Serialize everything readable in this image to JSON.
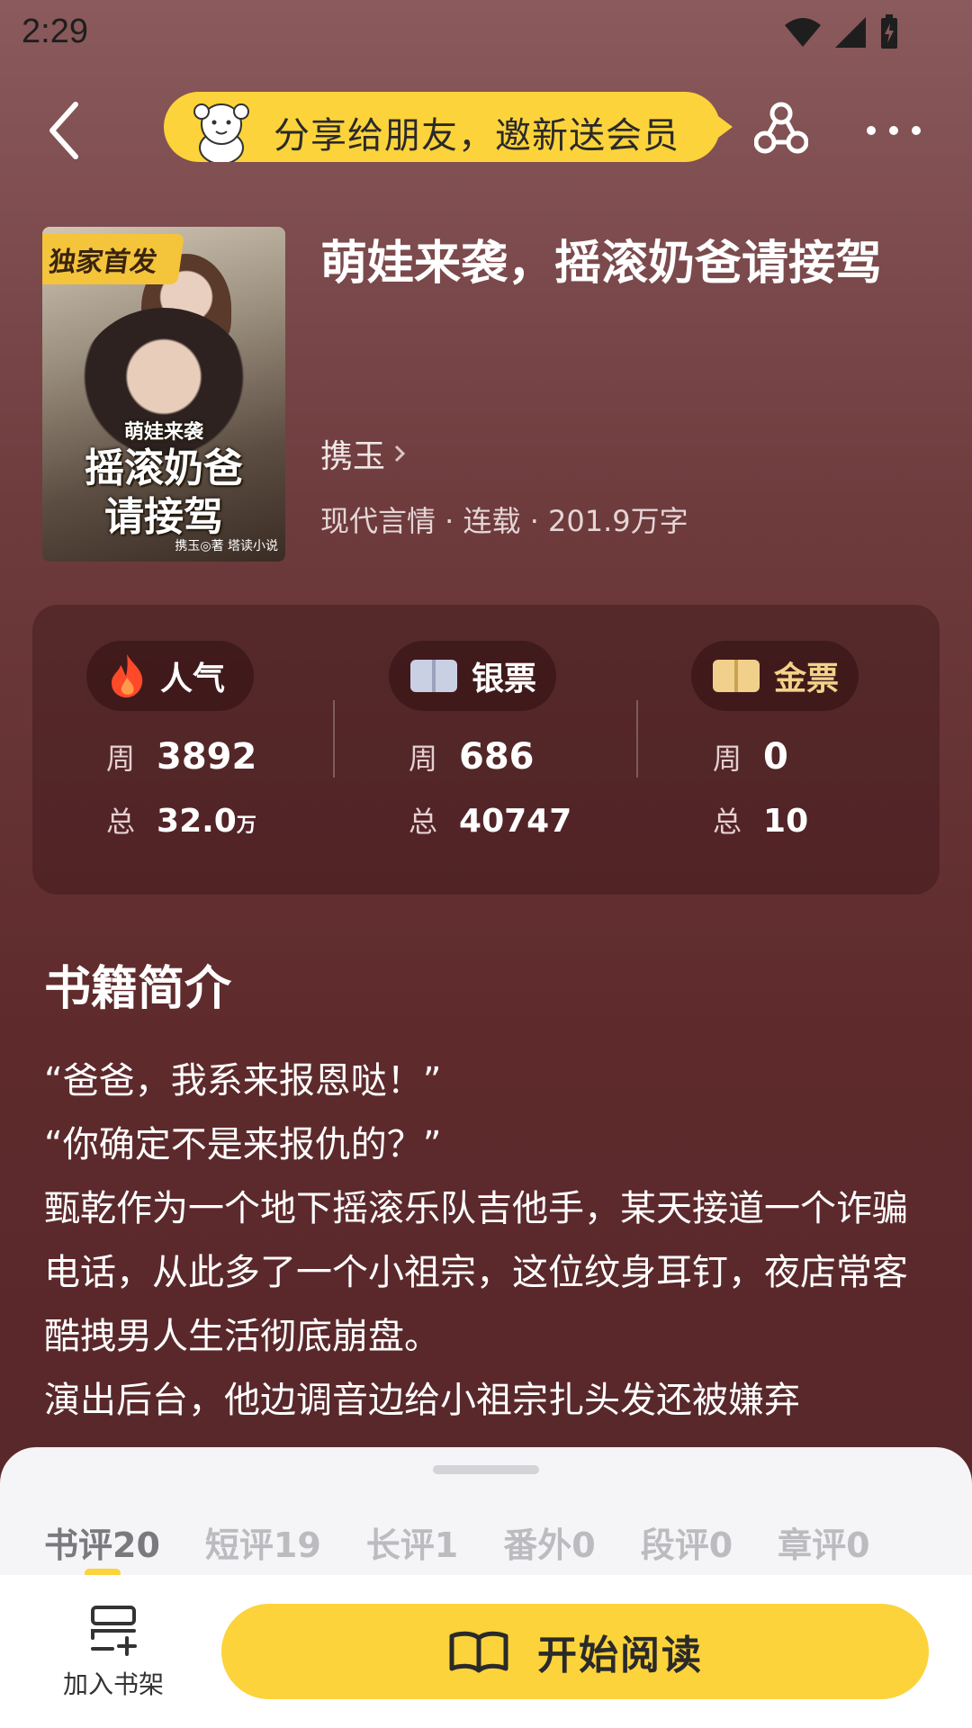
{
  "status_bar": {
    "time": "2:29"
  },
  "header": {
    "share_banner": "分享给朋友，邀新送会员"
  },
  "book": {
    "cover_badge": "独家首发",
    "cover_title_small": "萌娃来袭",
    "cover_title_line1": "摇滚奶爸",
    "cover_title_line2": "请接驾",
    "cover_footer": "携玉◎著  塔读小说",
    "title": "萌娃来袭，摇滚奶爸请接驾",
    "author": "携玉",
    "meta": "现代言情 · 连载 · 201.9万字"
  },
  "stats": [
    {
      "label": "人气",
      "week_label": "周",
      "week": "3892",
      "total_label": "总",
      "total": "32.0",
      "total_unit": "万"
    },
    {
      "label": "银票",
      "week_label": "周",
      "week": "686",
      "total_label": "总",
      "total": "40747",
      "total_unit": ""
    },
    {
      "label": "金票",
      "week_label": "周",
      "week": "0",
      "total_label": "总",
      "total": "10",
      "total_unit": ""
    }
  ],
  "intro": {
    "title": "书籍简介",
    "lines": [
      "“爸爸，我系来报恩哒！”",
      "“你确定不是来报仇的？”",
      "甄乾作为一个地下摇滚乐队吉他手，某天接道一个诈骗电话，从此多了一个小祖宗，这位纹身耳钉，夜店常客酷拽男人生活彻底崩盘。",
      "演出后台，他边调音边给小祖宗扎头发还被嫌弃"
    ]
  },
  "tabs": [
    "书评20",
    "短评19",
    "长评1",
    "番外0",
    "段评0",
    "章评0"
  ],
  "actions": {
    "add_shelf": "加入书架",
    "start_reading": "开始阅读"
  },
  "colors": {
    "accent": "#fcd33a",
    "background": "#6e3b3d"
  }
}
